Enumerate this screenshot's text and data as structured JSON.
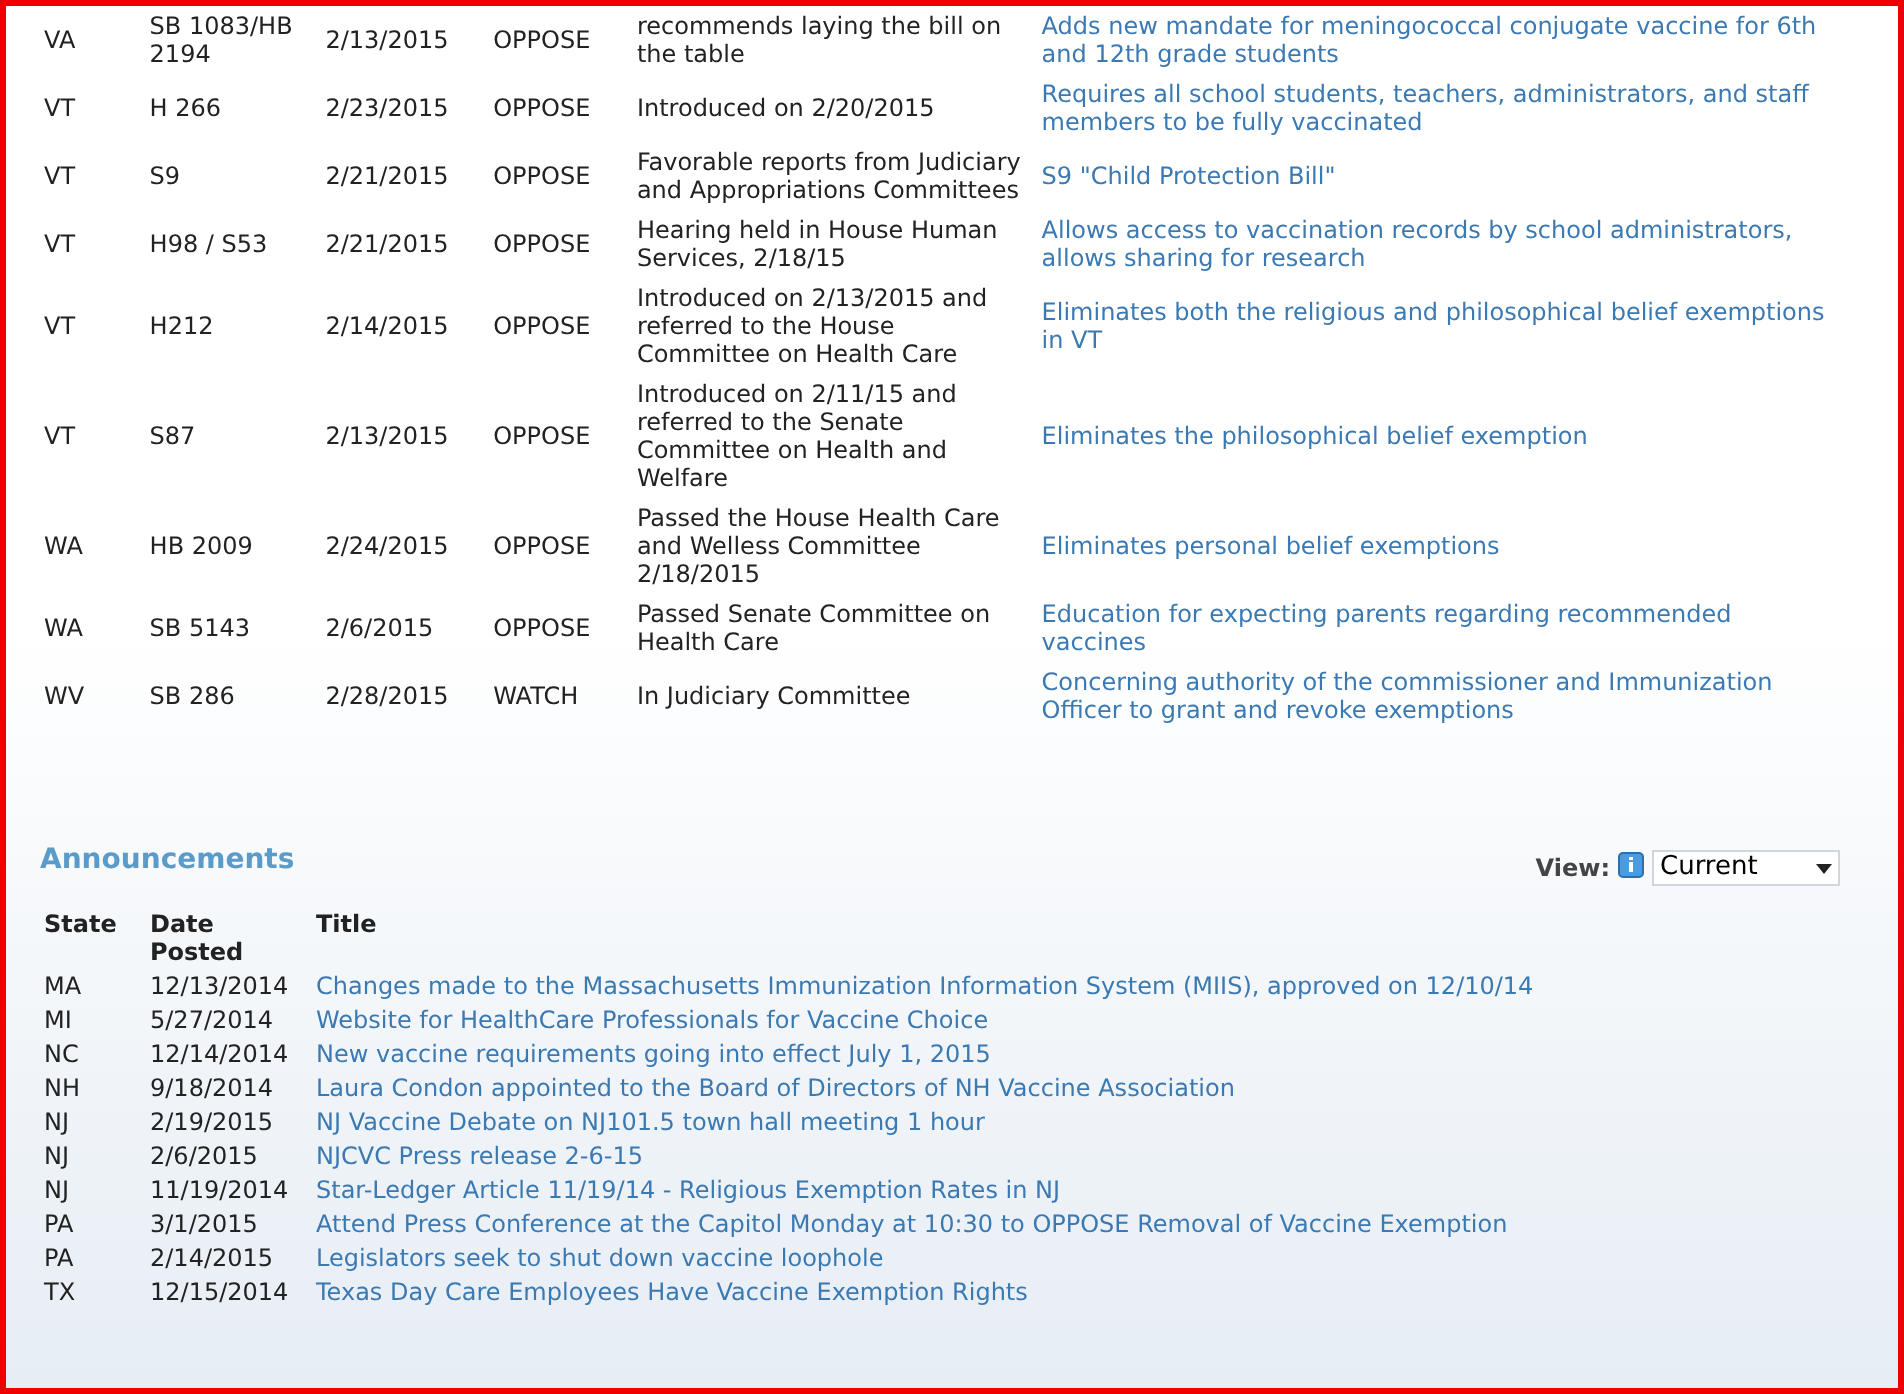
{
  "bills": [
    {
      "state": "VA",
      "bill": "SB 1083/HB 2194",
      "date": "2/13/2015",
      "position": "OPPOSE",
      "status": "recommends laying the bill on the table",
      "description": "Adds new mandate for meningococcal conjugate vaccine for 6th and 12th grade students"
    },
    {
      "state": "VT",
      "bill": "H 266",
      "date": "2/23/2015",
      "position": "OPPOSE",
      "status": "Introduced on 2/20/2015",
      "description": "Requires all school students, teachers, administrators, and staff members to be fully vaccinated"
    },
    {
      "state": "VT",
      "bill": "S9",
      "date": "2/21/2015",
      "position": "OPPOSE",
      "status": "Favorable reports from Judiciary and Appropriations Committees",
      "description": "S9 \"Child Protection Bill\""
    },
    {
      "state": "VT",
      "bill": "H98 / S53",
      "date": "2/21/2015",
      "position": "OPPOSE",
      "status": "Hearing held in House Human Services, 2/18/15",
      "description": "Allows access to vaccination records by school administrators, allows sharing for research"
    },
    {
      "state": "VT",
      "bill": "H212",
      "date": "2/14/2015",
      "position": "OPPOSE",
      "status": "Introduced on 2/13/2015 and referred to the House Committee on Health Care",
      "description": "Eliminates both the religious and philosophical belief exemptions in VT"
    },
    {
      "state": "VT",
      "bill": "S87",
      "date": "2/13/2015",
      "position": "OPPOSE",
      "status": "Introduced on 2/11/15 and referred to the Senate Committee on Health and Welfare",
      "description": "Eliminates the philosophical belief exemption"
    },
    {
      "state": "WA",
      "bill": "HB 2009",
      "date": "2/24/2015",
      "position": "OPPOSE",
      "status": "Passed the House Health Care and Welless Committee 2/18/2015",
      "description": "Eliminates personal belief exemptions"
    },
    {
      "state": "WA",
      "bill": "SB 5143",
      "date": "2/6/2015",
      "position": "OPPOSE",
      "status": "Passed Senate Committee on Health Care",
      "description": "Education for expecting parents regarding recommended vaccines"
    },
    {
      "state": "WV",
      "bill": "SB 286",
      "date": "2/28/2015",
      "position": "WATCH",
      "status": "In Judiciary Committee",
      "description": "Concerning authority of the commissioner and Immunization Officer to grant and revoke exemptions"
    }
  ],
  "announcements": {
    "title": "Announcements",
    "view_label": "View:",
    "view_value": "Current",
    "columns": [
      "State",
      "Date Posted",
      "Title"
    ],
    "rows": [
      {
        "state": "MA",
        "date": "12/13/2014",
        "title": "Changes made to the Massachusetts Immunization Information System (MIIS), approved on 12/10/14"
      },
      {
        "state": "MI",
        "date": "5/27/2014",
        "title": "Website for HealthCare Professionals for Vaccine Choice"
      },
      {
        "state": "NC",
        "date": "12/14/2014",
        "title": "New vaccine requirements going into effect July 1, 2015"
      },
      {
        "state": "NH",
        "date": "9/18/2014",
        "title": "Laura Condon appointed to the Board of Directors of NH Vaccine Association"
      },
      {
        "state": "NJ",
        "date": "2/19/2015",
        "title": "NJ Vaccine Debate on NJ101.5 town hall meeting 1 hour"
      },
      {
        "state": "NJ",
        "date": "2/6/2015",
        "title": "NJCVC Press release 2-6-15"
      },
      {
        "state": "NJ",
        "date": "11/19/2014",
        "title": "Star-Ledger Article 11/19/14 - Religious Exemption Rates in NJ"
      },
      {
        "state": "PA",
        "date": "3/1/2015",
        "title": "Attend Press Conference at the Capitol Monday at 10:30 to OPPOSE Removal of Vaccine Exemption"
      },
      {
        "state": "PA",
        "date": "2/14/2015",
        "title": "Legislators seek to shut down vaccine loophole"
      },
      {
        "state": "TX",
        "date": "12/15/2014",
        "title": "Texas Day Care Employees Have Vaccine Exemption Rights"
      }
    ]
  }
}
